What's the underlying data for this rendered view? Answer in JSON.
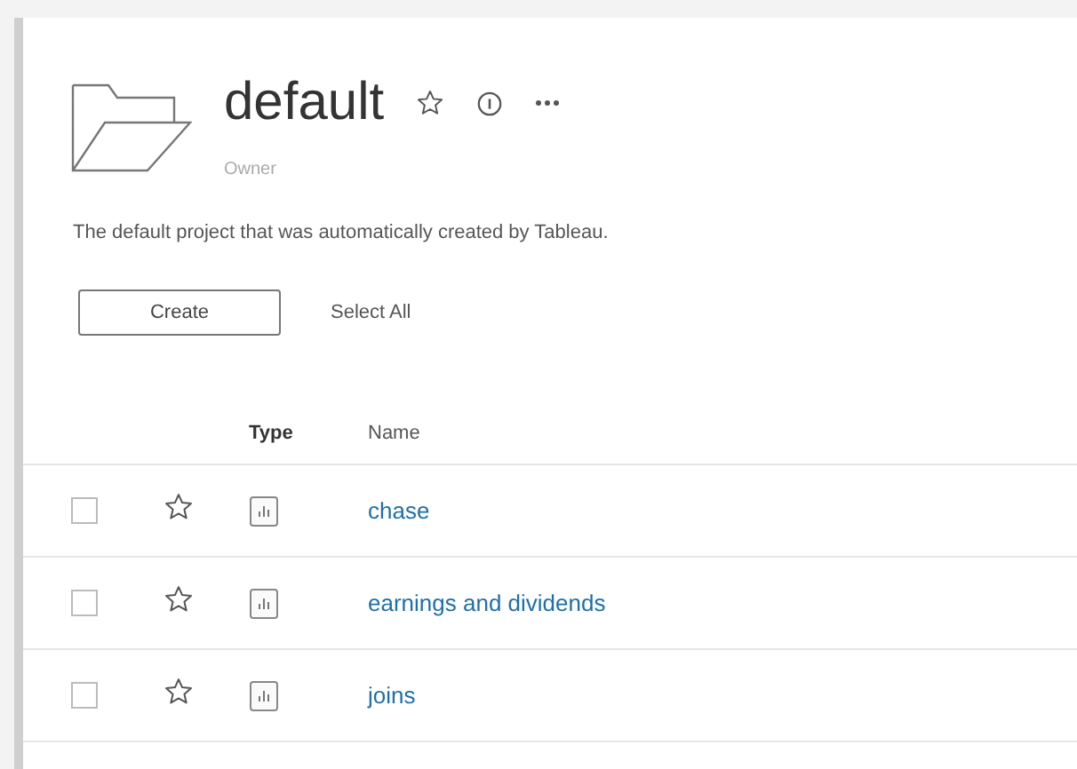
{
  "project": {
    "title": "default",
    "favorite": false,
    "owner_label": "Owner",
    "description": "The default project that was automatically created by Tableau."
  },
  "toolbar": {
    "create": "Create",
    "select_all": "Select All"
  },
  "table": {
    "columns": [
      "Type",
      "Name"
    ],
    "rows": [
      {
        "name": "chase",
        "checked": false,
        "favorite": false
      },
      {
        "name": "earnings and dividends",
        "checked": false,
        "favorite": false
      },
      {
        "name": "joins",
        "checked": false,
        "favorite": false
      }
    ]
  }
}
